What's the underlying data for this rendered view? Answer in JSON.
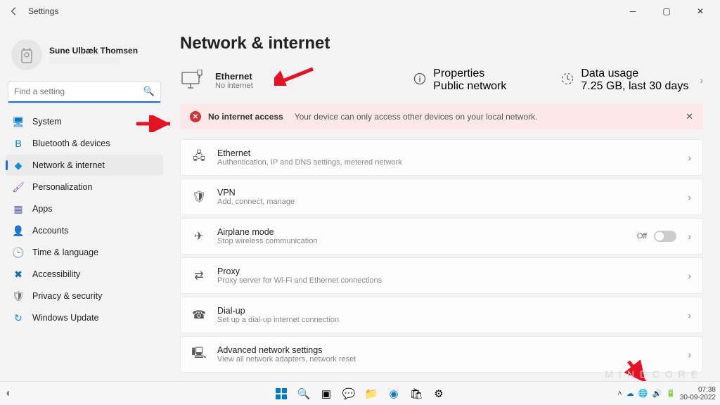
{
  "window": {
    "title": "Settings"
  },
  "profile": {
    "name": "Sune Ulbæk Thomsen"
  },
  "search": {
    "placeholder": "Find a setting"
  },
  "nav": [
    {
      "label": "System",
      "icon": "🖥",
      "color": "#0078d4"
    },
    {
      "label": "Bluetooth & devices",
      "icon": "B",
      "color": "#0078d4"
    },
    {
      "label": "Network & internet",
      "icon": "◆",
      "color": "#0b8fd6",
      "active": true
    },
    {
      "label": "Personalization",
      "icon": "🖌",
      "color": "#7b5ea7"
    },
    {
      "label": "Apps",
      "icon": "▦",
      "color": "#6264a7"
    },
    {
      "label": "Accounts",
      "icon": "👤",
      "color": "#f28c28"
    },
    {
      "label": "Time & language",
      "icon": "🕒",
      "color": "#4a8f3c"
    },
    {
      "label": "Accessibility",
      "icon": "✖",
      "color": "#1067b8"
    },
    {
      "label": "Privacy & security",
      "icon": "🛡",
      "color": "#6e6e6e"
    },
    {
      "label": "Windows Update",
      "icon": "↻",
      "color": "#1a88d6"
    }
  ],
  "heading": "Network & internet",
  "status": {
    "ethernet": {
      "title": "Ethernet",
      "sub": "No internet"
    },
    "properties": {
      "title": "Properties",
      "sub": "Public network"
    },
    "datausage": {
      "title": "Data usage",
      "sub": "7.25 GB, last 30 days"
    }
  },
  "alert": {
    "title": "No internet access",
    "text": "Your device can only access other devices on your local network."
  },
  "cards": [
    {
      "title": "Ethernet",
      "sub": "Authentication, IP and DNS settings, metered network",
      "icon": "🖧"
    },
    {
      "title": "VPN",
      "sub": "Add, connect, manage",
      "icon": "🛡"
    },
    {
      "title": "Airplane mode",
      "sub": "Stop wireless communication",
      "icon": "✈",
      "toggle": "Off"
    },
    {
      "title": "Proxy",
      "sub": "Proxy server for Wi-Fi and Ethernet connections",
      "icon": "⇄"
    },
    {
      "title": "Dial-up",
      "sub": "Set up a dial-up internet connection",
      "icon": "☎"
    },
    {
      "title": "Advanced network settings",
      "sub": "View all network adapters, network reset",
      "icon": "🖳"
    }
  ],
  "taskbar": {
    "time": "07:38",
    "date": "30-09-2022"
  },
  "watermark": "M I N D C O R E"
}
